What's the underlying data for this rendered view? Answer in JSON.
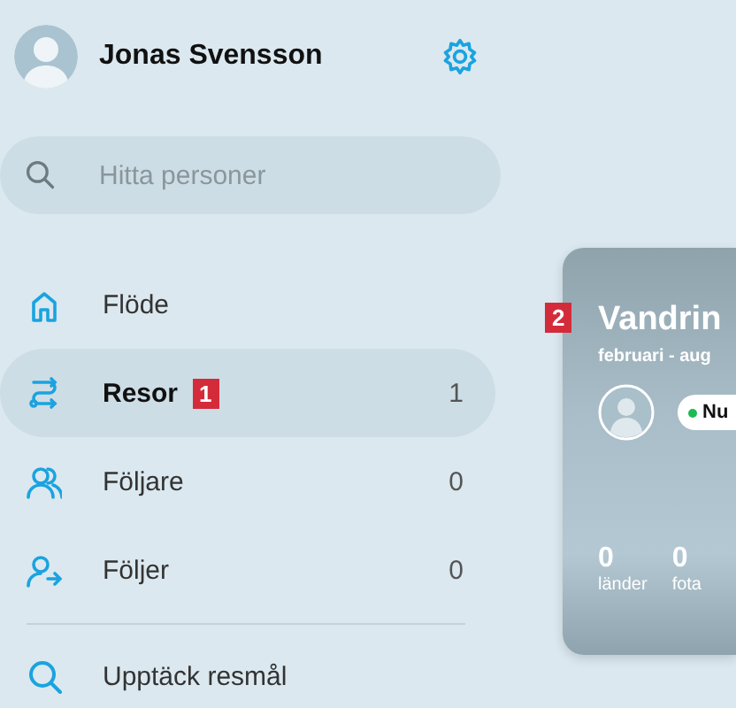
{
  "profile": {
    "name": "Jonas Svensson"
  },
  "search": {
    "placeholder": "Hitta personer"
  },
  "nav": [
    {
      "kind": "home",
      "label": "Flöde",
      "selected": false,
      "divider_before": false
    },
    {
      "kind": "route",
      "label": "Resor",
      "badge": "1",
      "count": "1",
      "selected": true,
      "divider_before": false
    },
    {
      "kind": "followers",
      "label": "Följare",
      "count": "0",
      "selected": false,
      "divider_before": false
    },
    {
      "kind": "following",
      "label": "Följer",
      "count": "0",
      "selected": false,
      "divider_before": false
    },
    {
      "kind": "search",
      "label": "Upptäck resmål",
      "selected": false,
      "divider_before": true
    }
  ],
  "trip_card": {
    "badge": "2",
    "title": "Vandrin",
    "dates": "februari - aug",
    "status": {
      "label": "Nu"
    },
    "stats": [
      {
        "value": "0",
        "label": "länder"
      },
      {
        "value": "0",
        "label": "fota"
      }
    ]
  }
}
